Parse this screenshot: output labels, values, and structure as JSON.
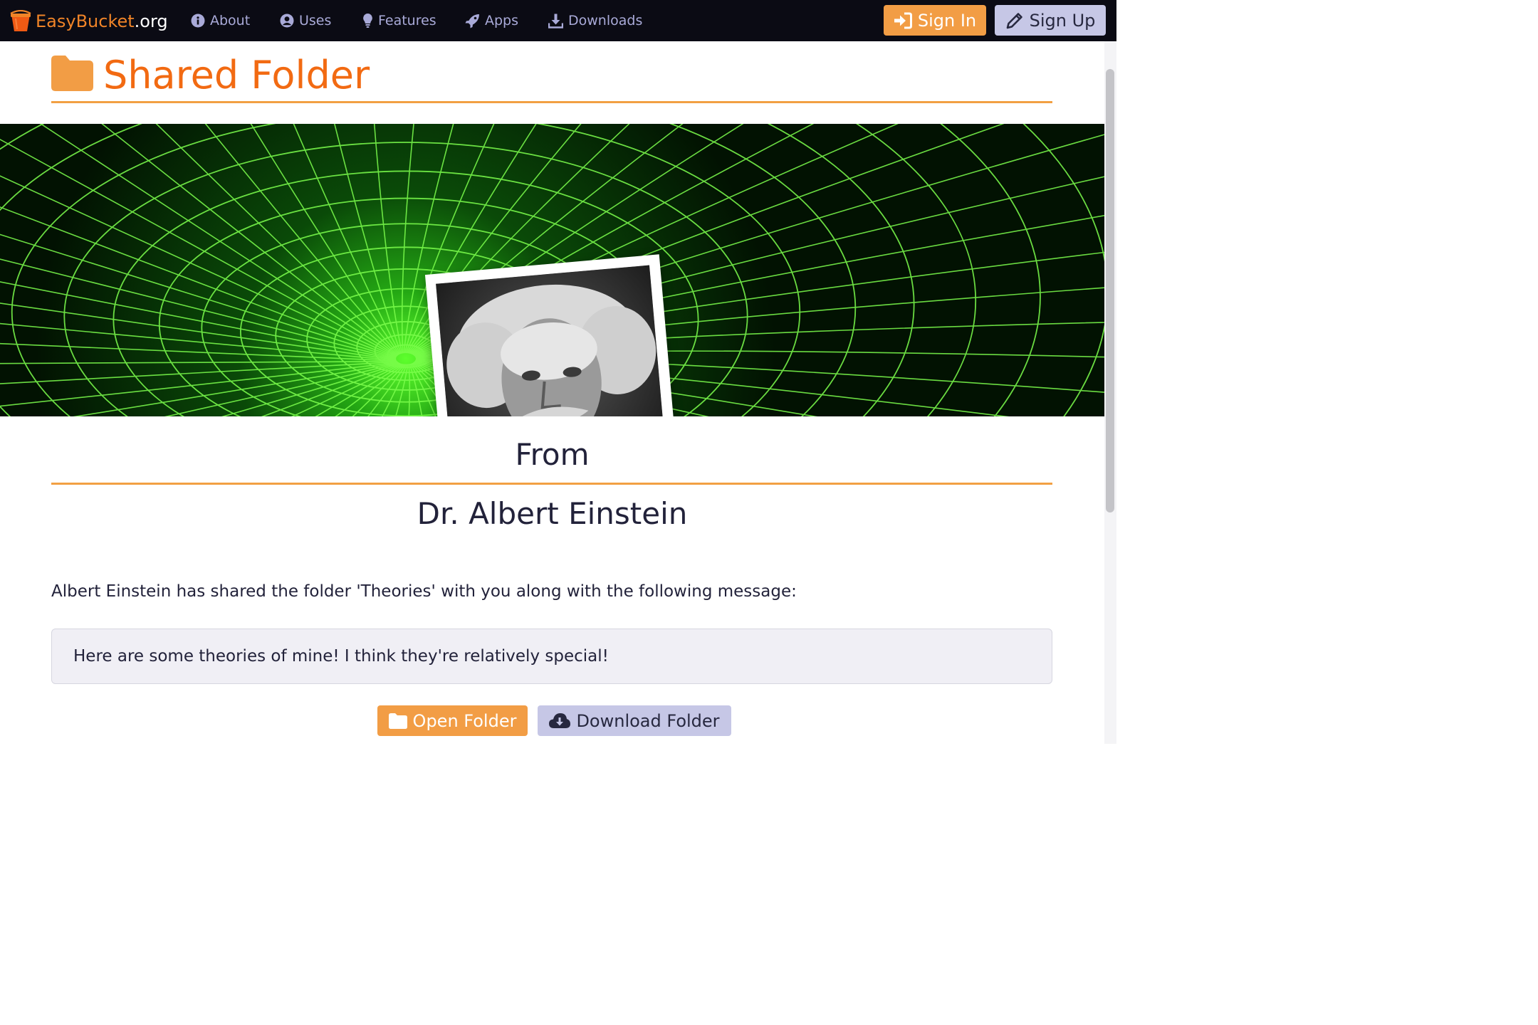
{
  "navbar": {
    "brand": {
      "part1": "EasyBucket",
      "part2": ".org",
      "icon": "bucket-icon"
    },
    "items": [
      {
        "label": "About",
        "icon": "info-circle-icon"
      },
      {
        "label": "Uses",
        "icon": "user-circle-icon"
      },
      {
        "label": "Features",
        "icon": "lightbulb-icon"
      },
      {
        "label": "Apps",
        "icon": "rocket-icon"
      },
      {
        "label": "Downloads",
        "icon": "download-icon"
      }
    ],
    "sign_in": {
      "label": "Sign In",
      "icon": "sign-in-icon"
    },
    "sign_up": {
      "label": "Sign Up",
      "icon": "pencil-icon"
    }
  },
  "page": {
    "title": "Shared Folder",
    "title_icon": "folder-icon",
    "hero_image": "warped-spacetime-grid",
    "profile_photo": "albert-einstein-portrait"
  },
  "share": {
    "from_label": "From",
    "sender_name": "Dr. Albert Einstein",
    "intro": "Albert Einstein has shared the folder 'Theories' with you along with the following message:",
    "message": "Here are some theories of mine! I think they're relatively special!"
  },
  "actions": {
    "open_folder": {
      "label": "Open Folder",
      "icon": "folder-open-icon"
    },
    "download_folder": {
      "label": "Download Folder",
      "icon": "cloud-download-icon"
    }
  },
  "colors": {
    "navbar_bg": "#0b0b14",
    "nav_text": "#a9aad8",
    "brand_orange": "#f08428",
    "title_orange": "#f26a12",
    "accent_orange": "#f29d45",
    "rule_orange": "#f2a043",
    "lavender": "#c6c7e6",
    "text_dark": "#22223a",
    "message_bg": "#f0eff5",
    "grid_green": "#7dff4d"
  }
}
